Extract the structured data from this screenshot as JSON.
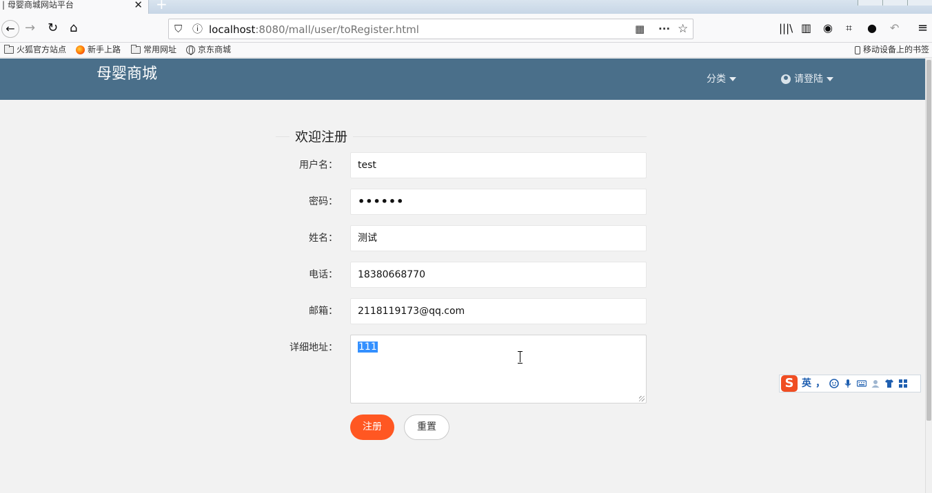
{
  "browser": {
    "tab_title": "| 母婴商城网站平台",
    "tab_close": "✕",
    "new_tab": "+",
    "url_host": "localhost",
    "url_rest": ":8080/mall/user/toRegister.html",
    "bookmarks": [
      "火狐官方站点",
      "新手上路",
      "常用网址",
      "京东商城"
    ],
    "mobile_bookmarks": "移动设备上的书签"
  },
  "site": {
    "brand": "母婴商城",
    "menu": {
      "category": "分类",
      "login": "请登陆"
    }
  },
  "form": {
    "legend": "欢迎注册",
    "labels": {
      "username": "用户名：",
      "password": "密码：",
      "name": "姓名：",
      "phone": "电话：",
      "email": "邮箱：",
      "address": "详细地址："
    },
    "values": {
      "username": "test",
      "password": "••••••",
      "name": "测试",
      "phone": "18380668770",
      "email": "2118119173@qq.com",
      "address": "111"
    },
    "buttons": {
      "submit": "注册",
      "reset": "重置"
    }
  },
  "ime": {
    "logo": "S",
    "mode": "英",
    "punct": "，"
  }
}
